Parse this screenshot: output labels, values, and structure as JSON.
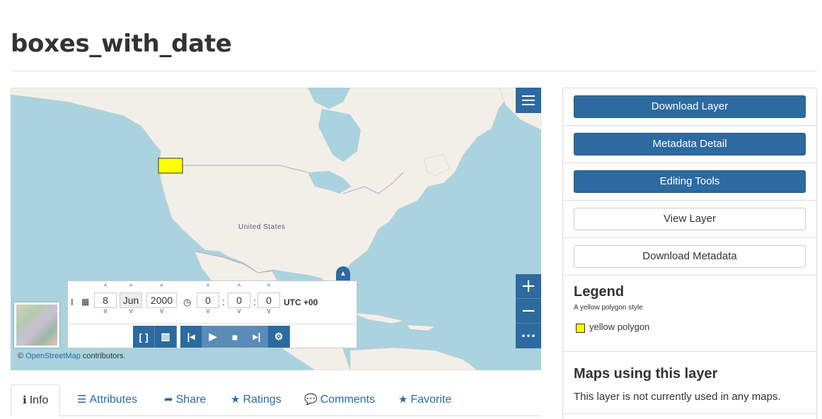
{
  "page": {
    "title": "boxes_with_date"
  },
  "map": {
    "country_label": "United States",
    "feature_fill": "#ffff00",
    "zoom_in": "+",
    "zoom_out": "−",
    "more": "•••",
    "attribution": {
      "prefix": "©",
      "link": "OpenStreetMap",
      "suffix": "contributors."
    }
  },
  "time_panel": {
    "day": "8",
    "month": "Jun",
    "year": "2000",
    "hour": "0",
    "minute": "0",
    "second": "0",
    "colon": ":",
    "timezone": "UTC +00",
    "buttons": [
      "range-icon",
      "layers-refresh-icon",
      "skip-back-icon",
      "play-icon",
      "stop-icon",
      "skip-forward-icon",
      "gear-icon"
    ]
  },
  "tabs": [
    {
      "label": "Info",
      "icon": "info-icon",
      "active": true
    },
    {
      "label": "Attributes",
      "icon": "list-icon"
    },
    {
      "label": "Share",
      "icon": "share-icon"
    },
    {
      "label": "Ratings",
      "icon": "star-icon"
    },
    {
      "label": "Comments",
      "icon": "comment-icon"
    },
    {
      "label": "Favorite",
      "icon": "star-icon"
    }
  ],
  "sidebar": {
    "download_layer": "Download Layer",
    "metadata_detail": "Metadata Detail",
    "editing_tools": "Editing Tools",
    "view_layer": "View Layer",
    "download_metadata": "Download Metadata",
    "legend": {
      "title": "Legend",
      "style_name": "A yellow polygon style",
      "item_label": "yellow polygon",
      "item_color": "#ffff00"
    },
    "maps": {
      "title": "Maps using this layer",
      "text": "This layer is not currently used in any maps."
    }
  },
  "colors": {
    "primary": "#2c6aa0",
    "ocean": "#aad3df",
    "land": "#f2efe9"
  }
}
